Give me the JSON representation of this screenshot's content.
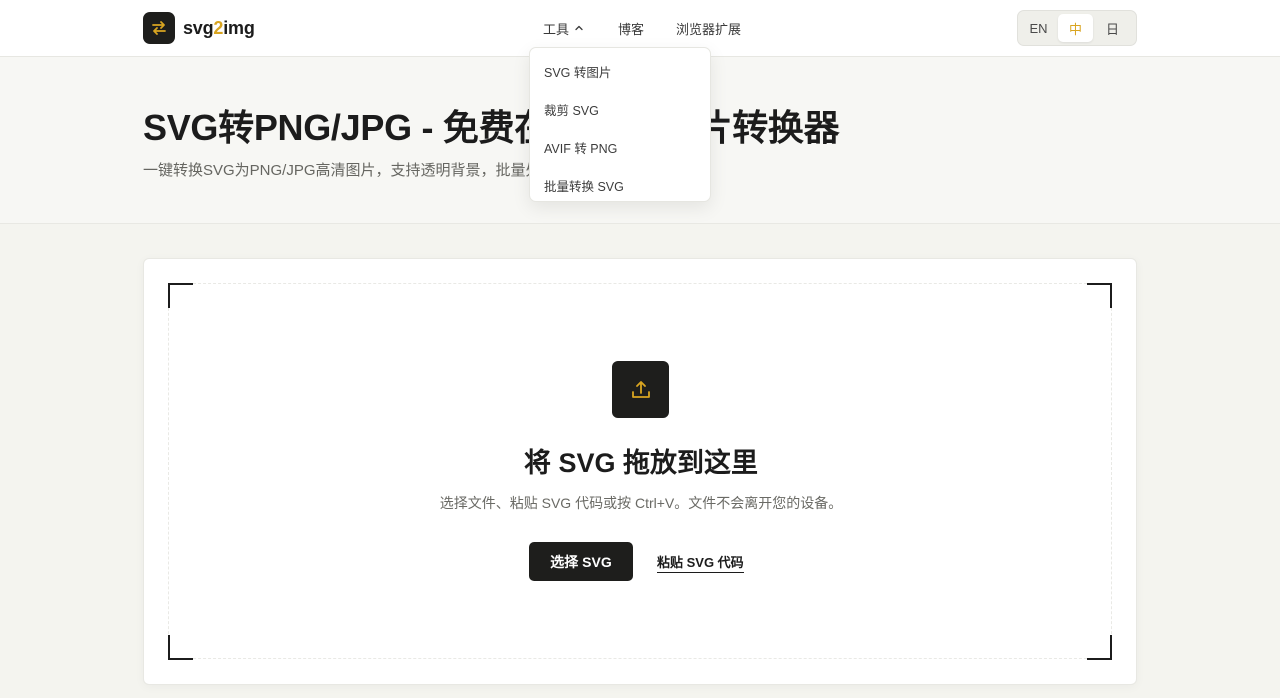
{
  "brand": {
    "name_pre": "svg",
    "name_accent": "2",
    "name_post": "img",
    "accent_color": "#d9a521"
  },
  "nav": {
    "tools_label": "工具",
    "blog_label": "博客",
    "extension_label": "浏览器扩展"
  },
  "languages": [
    {
      "label": "EN",
      "active": false
    },
    {
      "label": "中",
      "active": true
    },
    {
      "label": "日",
      "active": false
    }
  ],
  "tools_menu": [
    "SVG 转图片",
    "裁剪 SVG",
    "AVIF 转 PNG",
    "批量转换 SVG"
  ],
  "hero": {
    "title": "SVG转PNG/JPG - 免费在线SVG图片转换器",
    "subtitle": "一键转换SVG为PNG/JPG高清图片，支持透明背景，批量处理"
  },
  "dropzone": {
    "icon": "upload-icon",
    "title": "将 SVG 拖放到这里",
    "description": "选择文件、粘贴 SVG 代码或按 Ctrl+V。文件不会离开您的设备。",
    "choose_label": "选择 SVG",
    "paste_label": "粘贴 SVG 代码"
  }
}
